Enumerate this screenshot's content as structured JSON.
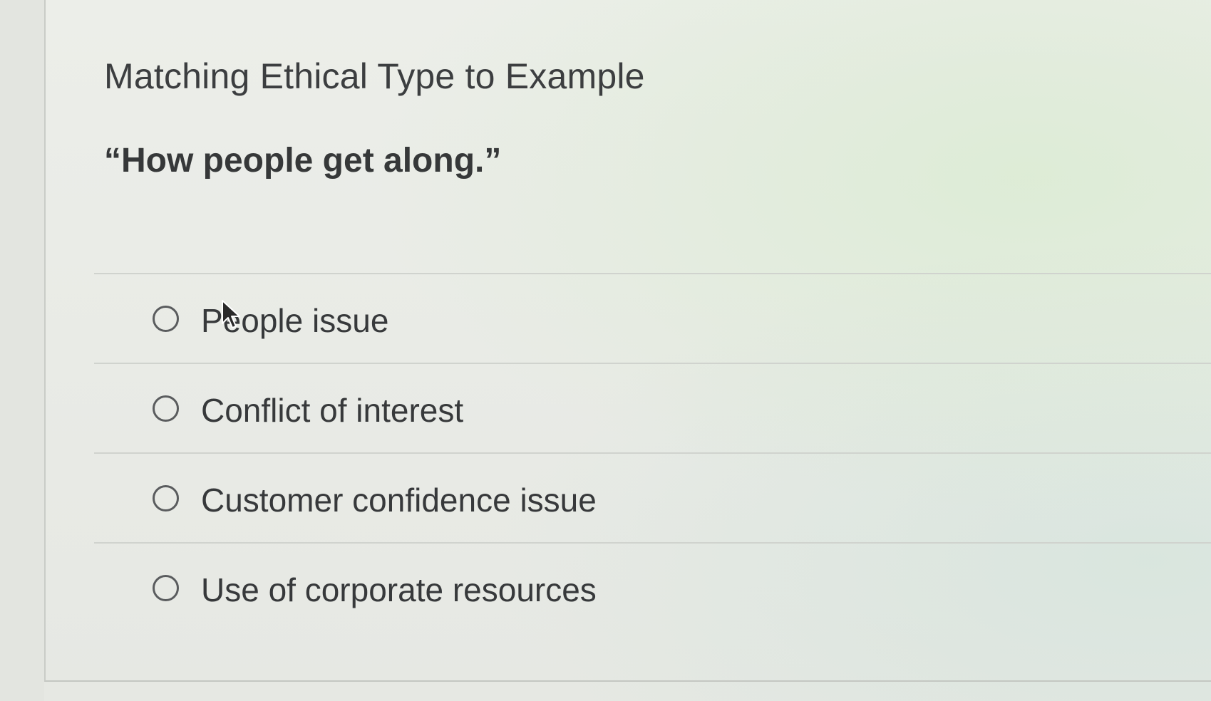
{
  "question": {
    "title": "Matching Ethical Type to Example",
    "prompt": "“How people get along.”",
    "options": [
      {
        "label": "People issue",
        "selected": false
      },
      {
        "label": "Conflict of interest",
        "selected": false
      },
      {
        "label": "Customer confidence issue",
        "selected": false
      },
      {
        "label": "Use of corporate resources",
        "selected": false
      }
    ]
  },
  "cursor": {
    "icon": "mouse-pointer-icon"
  },
  "colors": {
    "text": "#3b3d3e",
    "radio_border": "#5a5c5e",
    "divider": "#d0d3ce",
    "background": "#e9ebe6"
  }
}
